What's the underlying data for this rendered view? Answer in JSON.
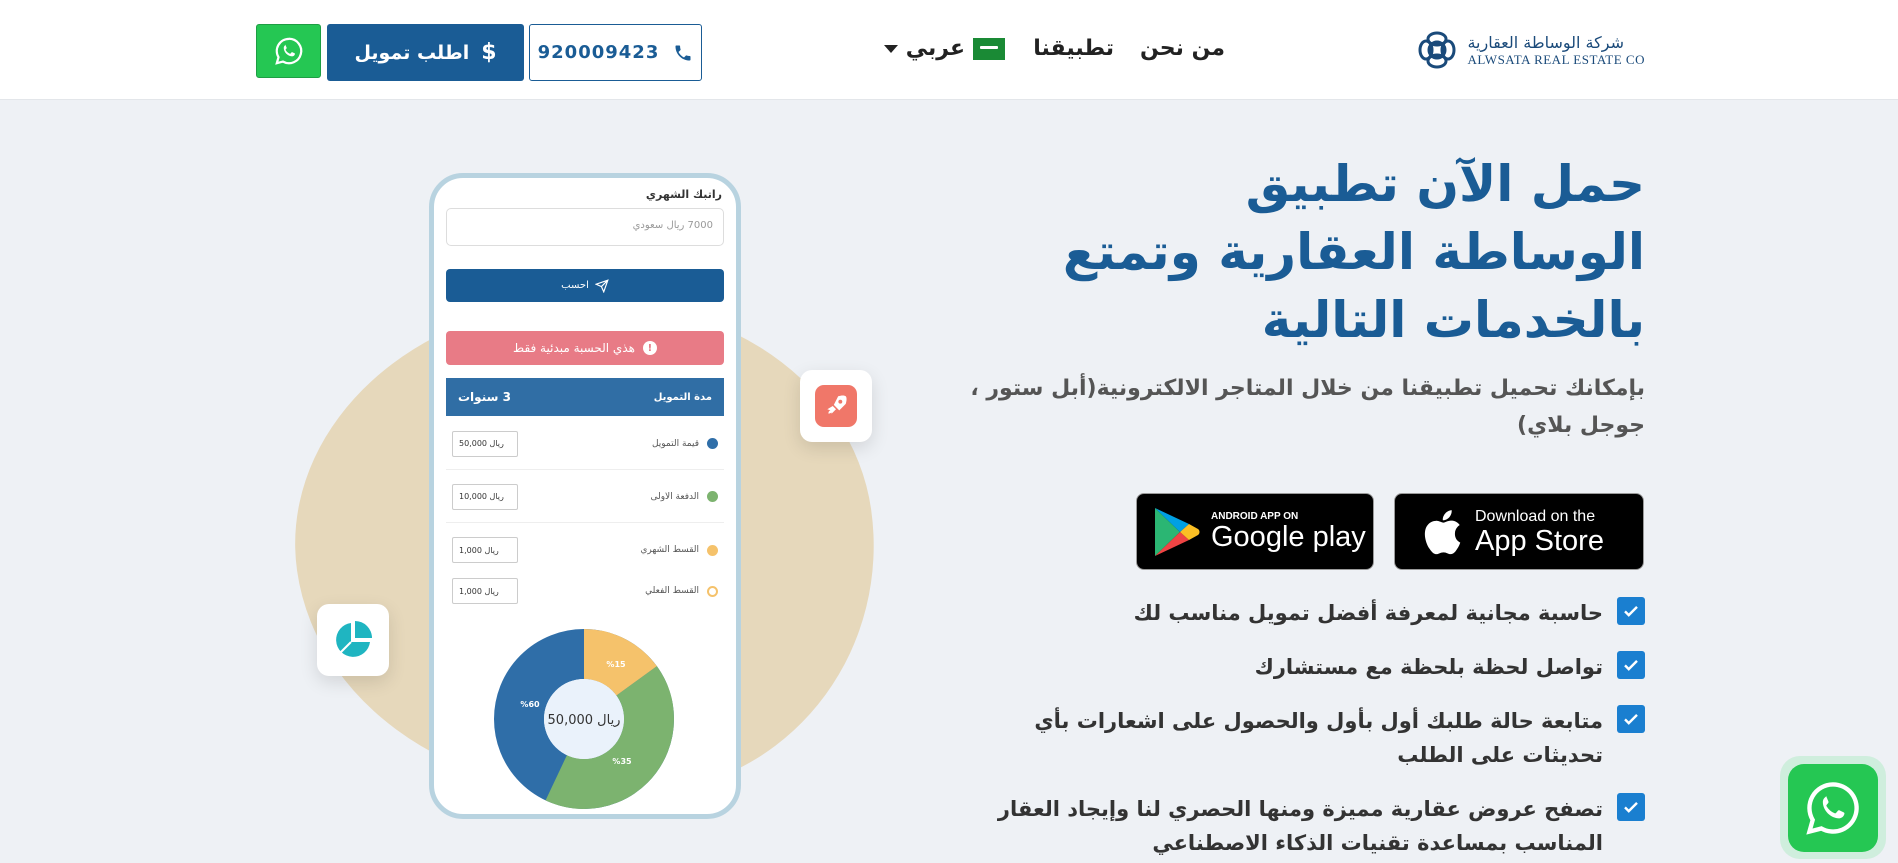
{
  "header": {
    "logo_ar": "شركة الوساطة العقارية",
    "logo_en": "ALWSATA REAL ESTATE CO",
    "nav": {
      "about": "من نحن",
      "app": "تطبيقنا",
      "lang": "عربي"
    },
    "phone_number": "920009423",
    "finance_button": "اطلب تمويل"
  },
  "hero": {
    "title": "حمل الآن تطبيق الوساطة العقارية وتمتع بالخدمات التالية",
    "subtitle": "بإمكانك تحميل تطبيقنا من خلال المتاجر الالكترونية(أبل ستور ، جوجل بلاي)"
  },
  "stores": {
    "apple_small": "Download on the",
    "apple_big": "App Store",
    "google_small": "ANDROID APP ON",
    "google_big": "Google play"
  },
  "features": [
    "حاسبة مجانية لمعرفة أفضل تمويل مناسب لك",
    "تواصل لحظة بلحظة مع مستشارك",
    "متابعة حالة طلبك أول بأول والحصول على اشعارات بأي تحديثات على الطلب",
    "تصفح عروض عقارية مميزة ومنها الحصري لنا وإيجاد العقار المناسب بمساعدة تقنيات الذكاء الاصطناعي"
  ],
  "phone_app": {
    "salary_label": "راتبك الشهري",
    "salary_placeholder": "7000 ريال سعودي",
    "calc_button": "احسب",
    "alert": "هذي الحسبة مبدئية فقط",
    "duration_label": "مدة التمويل",
    "duration_value": "3 سنوات",
    "rows": [
      {
        "label": "قيمة التمويل",
        "value": "50,000 ريال",
        "color": "#2f6ea8"
      },
      {
        "label": "الدفعة الاولى",
        "value": "10,000 ريال",
        "color": "#7cb36f"
      },
      {
        "label": "القسط الشهري",
        "value": "1,000 ريال",
        "color": "#f5c26b"
      },
      {
        "label": "القسط الفعلي",
        "value": "1,000 ريال",
        "color": "#f5c26b"
      }
    ],
    "donut_center": "50,000 ريال",
    "donut_labels": [
      "%60",
      "%35",
      "%15"
    ]
  },
  "colors": {
    "brand": "#1a5c95",
    "whatsapp": "#25c753",
    "check": "#1a7fd0",
    "blob": "#e6d8bb"
  }
}
